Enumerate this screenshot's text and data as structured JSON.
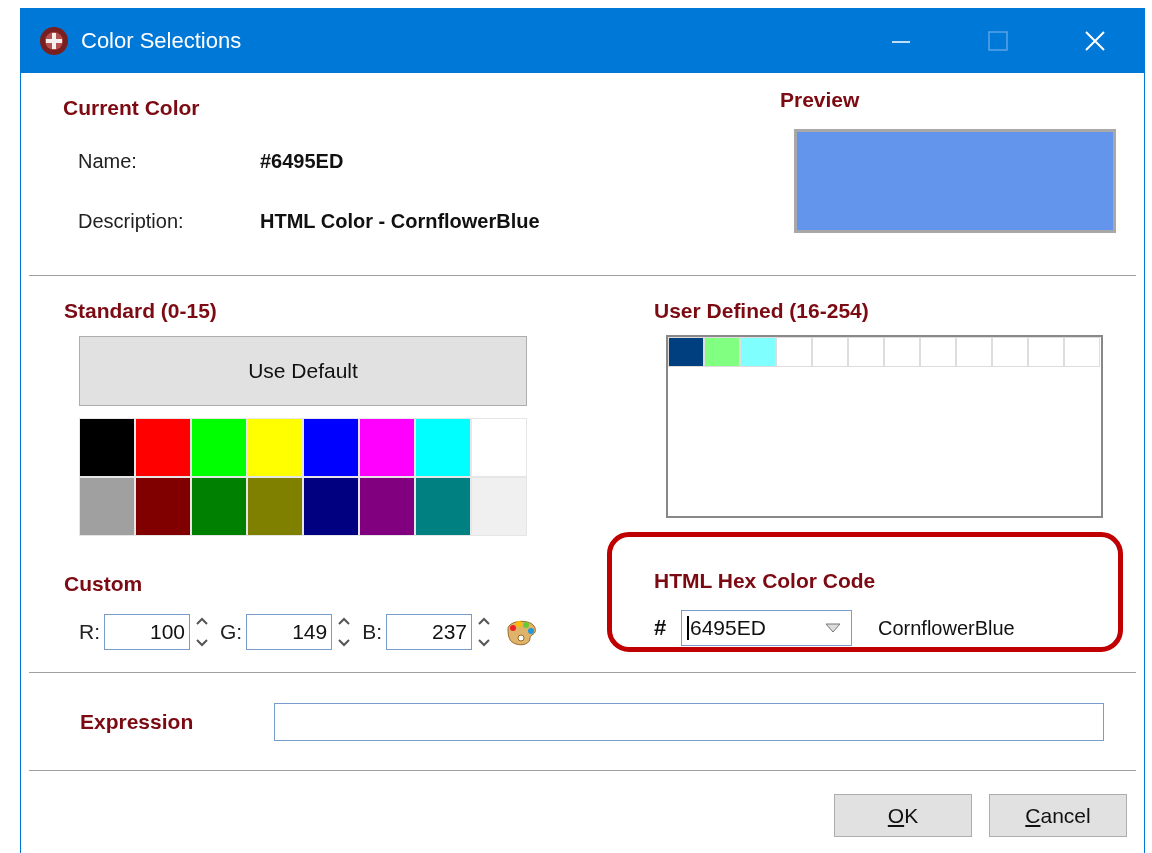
{
  "window": {
    "title": "Color Selections",
    "controls": [
      {
        "kind": "minimize",
        "disabled": false
      },
      {
        "kind": "maximize",
        "disabled": true
      },
      {
        "kind": "close",
        "disabled": false
      }
    ]
  },
  "current_color": {
    "heading": "Current Color",
    "name_label": "Name:",
    "name_value": "#6495ED",
    "description_label": "Description:",
    "description_value": "HTML Color - CornflowerBlue"
  },
  "preview": {
    "heading": "Preview",
    "color": "#6495ed"
  },
  "standard": {
    "heading": "Standard (0-15)",
    "default_button": "Use Default",
    "swatches": [
      {
        "color": "#000000"
      },
      {
        "color": "#ff0000"
      },
      {
        "color": "#00ff00"
      },
      {
        "color": "#ffff00"
      },
      {
        "color": "#0000ff"
      },
      {
        "color": "#ff00ff"
      },
      {
        "color": "#00ffff"
      },
      {
        "color": "#ffffff"
      },
      {
        "color": "#a0a0a0"
      },
      {
        "color": "#800000"
      },
      {
        "color": "#008000"
      },
      {
        "color": "#808000"
      },
      {
        "color": "#000080"
      },
      {
        "color": "#800080"
      },
      {
        "color": "#008080"
      },
      {
        "color": "#f0f0f0"
      }
    ]
  },
  "user_defined": {
    "heading": "User Defined (16-254)",
    "swatches": [
      {
        "color": "#003f7f"
      },
      {
        "color": "#80ff80"
      },
      {
        "color": "#80ffff"
      },
      {
        "color": "#ffffff"
      },
      {
        "color": "#ffffff"
      },
      {
        "color": "#ffffff"
      },
      {
        "color": "#ffffff"
      },
      {
        "color": "#ffffff"
      },
      {
        "color": "#ffffff"
      },
      {
        "color": "#ffffff"
      },
      {
        "color": "#ffffff"
      },
      {
        "color": "#ffffff"
      }
    ]
  },
  "custom": {
    "heading": "Custom",
    "channels": [
      {
        "label": "R:",
        "value": "100"
      },
      {
        "label": "G:",
        "value": "149"
      },
      {
        "label": "B:",
        "value": "237"
      }
    ]
  },
  "hex": {
    "heading": "HTML Hex Color Code",
    "prefix": "#",
    "value": "6495ED",
    "color_name": "CornflowerBlue",
    "highlighted": true
  },
  "expression": {
    "label": "Expression"
  },
  "buttons": [
    {
      "label": "OK",
      "mnemonic": true
    },
    {
      "label": "Cancel",
      "mnemonic": true
    }
  ]
}
